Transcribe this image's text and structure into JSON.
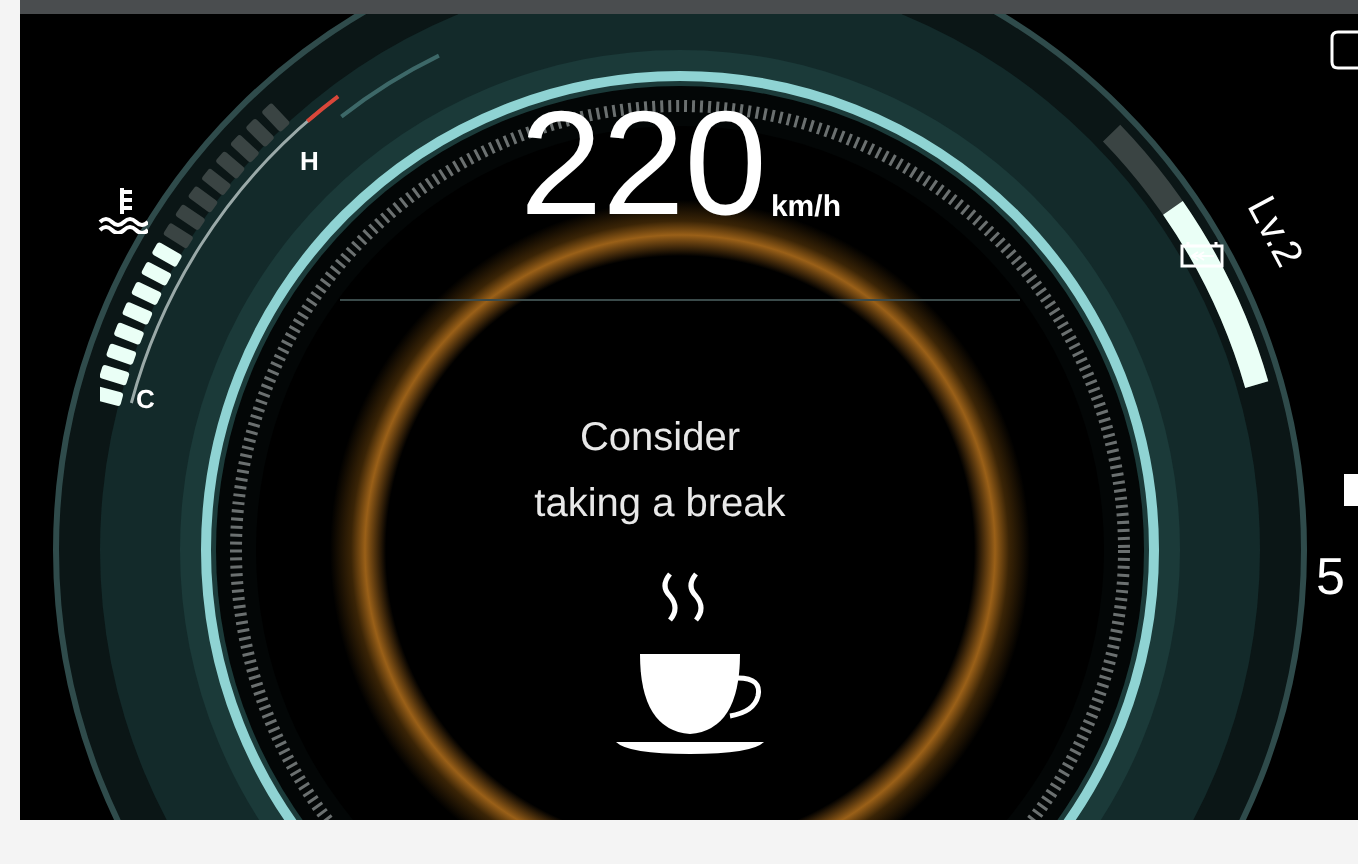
{
  "speedometer": {
    "speed": "220",
    "unit": "km/h"
  },
  "alert": {
    "message": "Consider\ntaking a break"
  },
  "temperature": {
    "hot_label": "H",
    "cold_label": "C",
    "level": 0.5
  },
  "regen": {
    "label": "Lv.2",
    "level": 0.67
  },
  "side_reading": "5"
}
